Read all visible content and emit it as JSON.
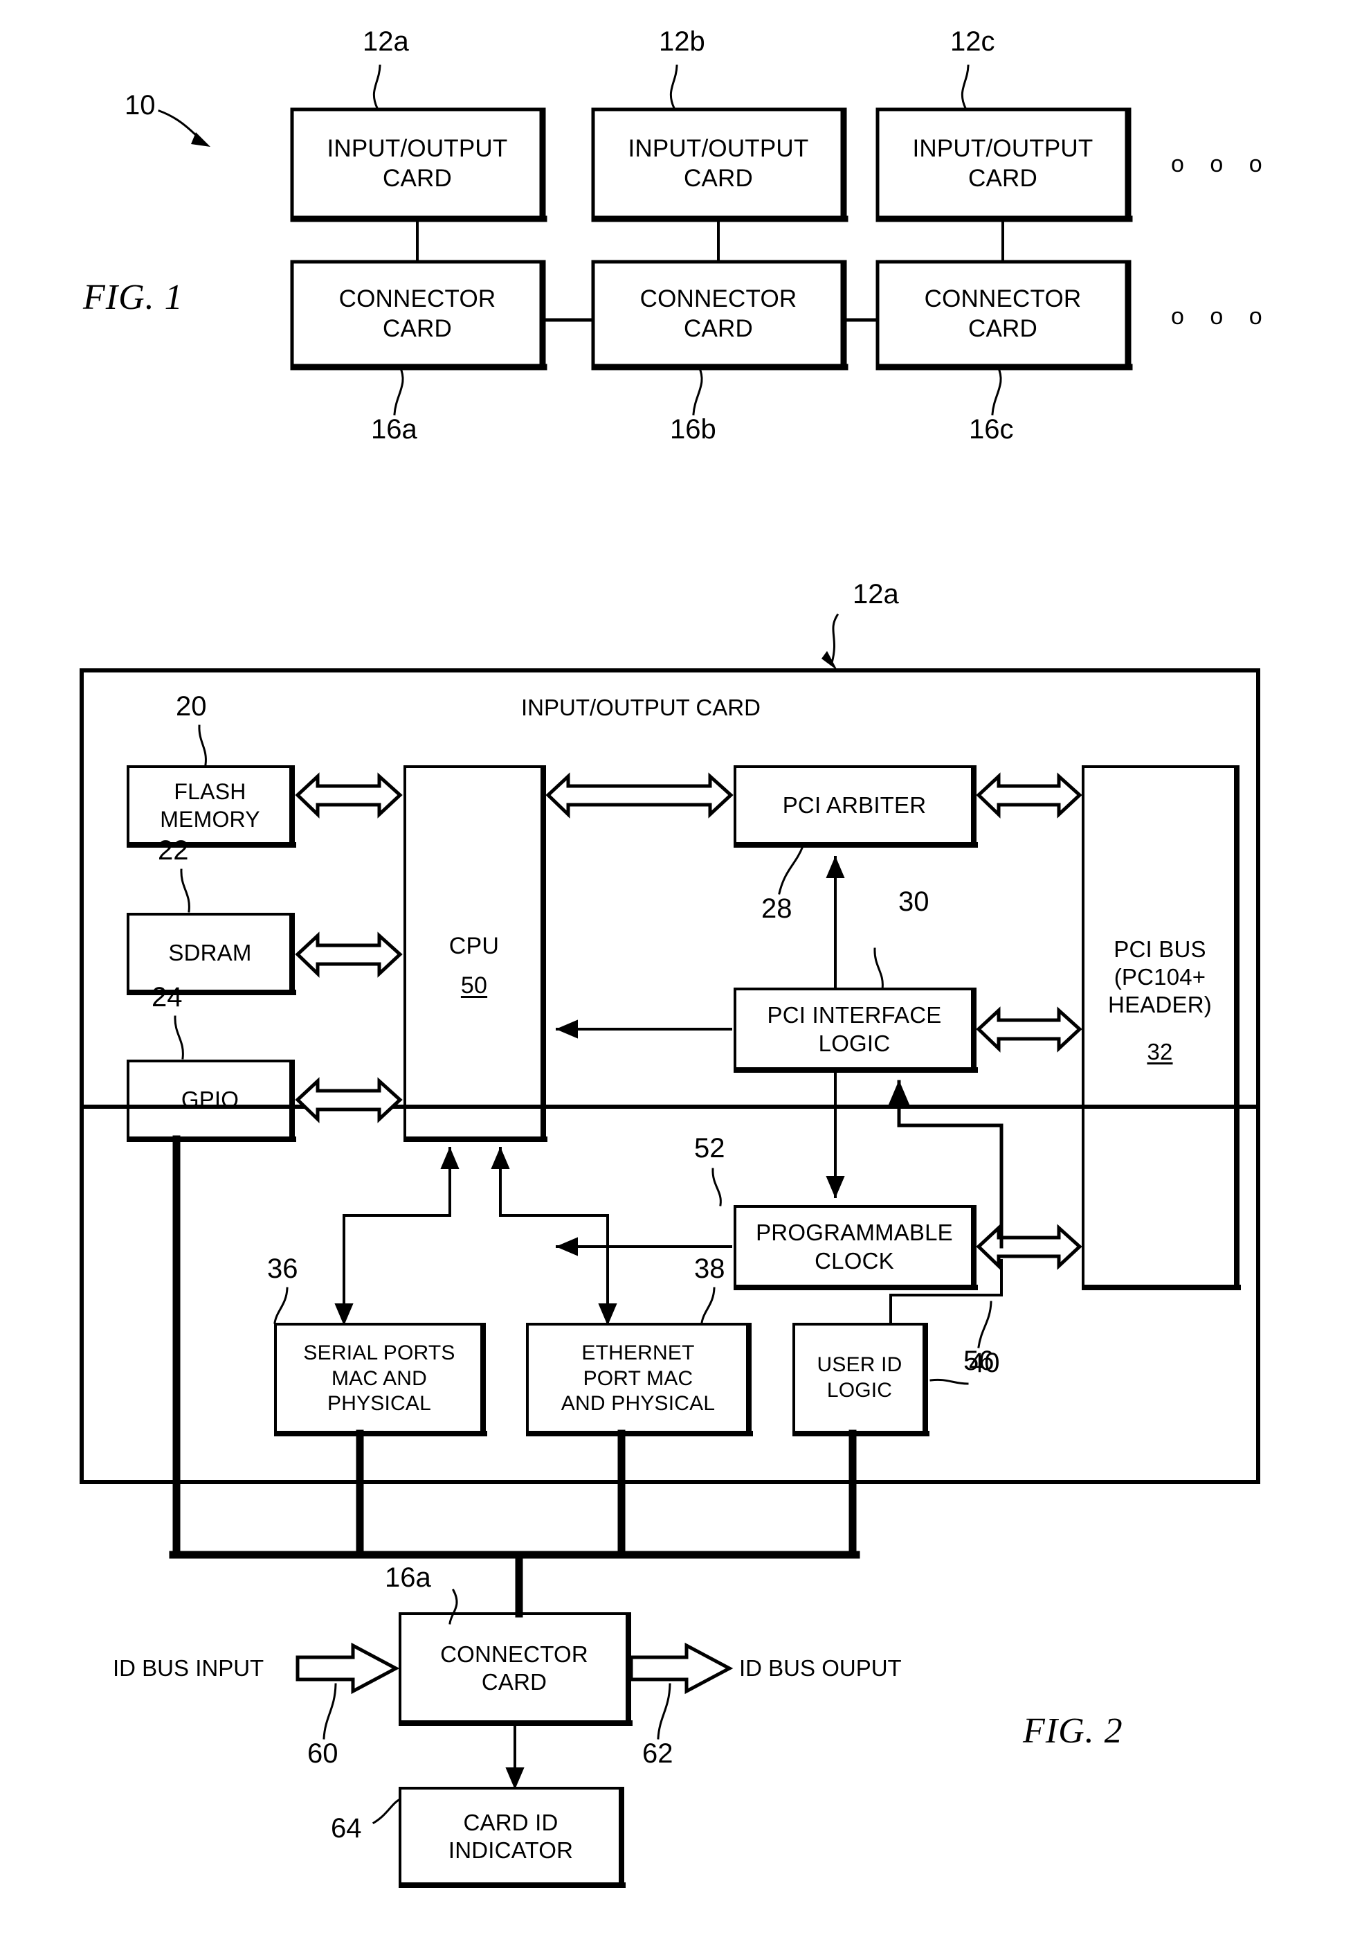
{
  "figure1": {
    "label": "FIG. 1",
    "system_ref": "10",
    "io_cards": [
      {
        "line1": "INPUT/OUTPUT",
        "line2": "CARD",
        "ref": "12a"
      },
      {
        "line1": "INPUT/OUTPUT",
        "line2": "CARD",
        "ref": "12b"
      },
      {
        "line1": "INPUT/OUTPUT",
        "line2": "CARD",
        "ref": "12c"
      }
    ],
    "connector_cards": [
      {
        "line1": "CONNECTOR",
        "line2": "CARD",
        "ref": "16a"
      },
      {
        "line1": "CONNECTOR",
        "line2": "CARD",
        "ref": "16b"
      },
      {
        "line1": "CONNECTOR",
        "line2": "CARD",
        "ref": "16c"
      }
    ],
    "ellipsis_top": "o o o",
    "ellipsis_bottom": "o o o"
  },
  "figure2": {
    "label": "FIG. 2",
    "card_ref": "12a",
    "card_title": "INPUT/OUTPUT CARD",
    "blocks": {
      "flash_memory": {
        "line1": "FLASH",
        "line2": "MEMORY",
        "ref": "20"
      },
      "sdram": {
        "line1": "SDRAM",
        "ref": "22"
      },
      "gpio": {
        "line1": "GPIO",
        "ref": "24"
      },
      "cpu": {
        "line1": "CPU",
        "ref": "50"
      },
      "pci_arbiter": {
        "line1": "PCI ARBITER",
        "ref": "28"
      },
      "pci_interface_logic": {
        "line1": "PCI INTERFACE",
        "line2": "LOGIC",
        "ref": "30"
      },
      "programmable_clock": {
        "line1": "PROGRAMMABLE",
        "line2": "CLOCK",
        "ref": "52"
      },
      "pci_bus": {
        "line1": "PCI BUS",
        "line2": "(PC104+",
        "line3": "HEADER)",
        "ref": "32"
      },
      "serial_ports": {
        "line1": "SERIAL PORTS",
        "line2": "MAC AND",
        "line3": "PHYSICAL",
        "ref": "36"
      },
      "ethernet_port": {
        "line1": "ETHERNET",
        "line2": "PORT MAC",
        "line3": "AND PHYSICAL",
        "ref": "38"
      },
      "user_id_logic": {
        "line1": "USER ID",
        "line2": "LOGIC",
        "ref": "40"
      },
      "connector_card": {
        "line1": "CONNECTOR",
        "line2": "CARD",
        "ref": "16a"
      },
      "card_id_indicator": {
        "line1": "CARD ID",
        "line2": "INDICATOR",
        "ref": "64"
      }
    },
    "bus_link_ref": "56",
    "id_bus_input_label": "ID BUS INPUT",
    "id_bus_input_ref": "60",
    "id_bus_output_label": "ID BUS OUPUT",
    "id_bus_output_ref": "62"
  },
  "colors": {
    "ink": "#000000",
    "paper": "#ffffff"
  }
}
